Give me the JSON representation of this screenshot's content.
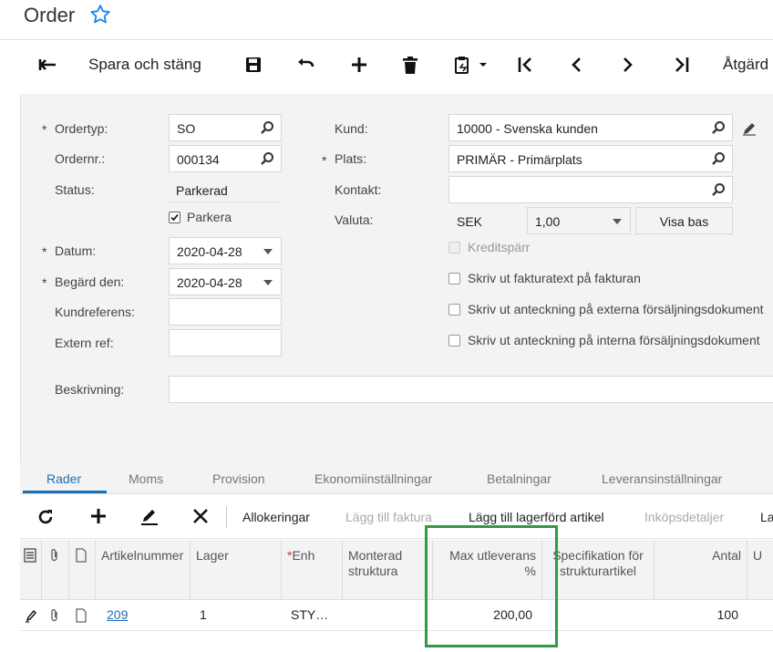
{
  "header": {
    "title": "Order"
  },
  "toolbar": {
    "save_close": "Spara och stäng",
    "actions": "Åtgärd"
  },
  "form": {
    "ordertyp_label": "Ordertyp:",
    "ordertyp_value": "SO",
    "ordernr_label": "Ordernr.:",
    "ordernr_value": "000134",
    "status_label": "Status:",
    "status_value": "Parkerad",
    "parkera_label": "Parkera",
    "datum_label": "Datum:",
    "datum_value": "2020-04-28",
    "begard_label": "Begärd den:",
    "begard_value": "2020-04-28",
    "kundref_label": "Kundreferens:",
    "kundref_value": "",
    "externref_label": "Extern ref:",
    "externref_value": "",
    "beskrivning_label": "Beskrivning:",
    "beskrivning_value": "",
    "kund_label": "Kund:",
    "kund_value": "10000 - Svenska kunden",
    "plats_label": "Plats:",
    "plats_value": "PRIMÄR - Primärplats",
    "kontakt_label": "Kontakt:",
    "kontakt_value": "",
    "valuta_label": "Valuta:",
    "valuta_code": "SEK",
    "valuta_rate": "1,00",
    "visa_bas": "Visa bas",
    "kreditsparr": "Kreditspärr",
    "skriv_fakturatext": "Skriv ut fakturatext på fakturan",
    "skriv_externa": "Skriv ut anteckning på externa försäljningsdokument",
    "skriv_interna": "Skriv ut anteckning på interna försäljningsdokument"
  },
  "tabs": [
    "Rader",
    "Moms",
    "Provision",
    "Ekonomiinställningar",
    "Betalningar",
    "Leveransinställningar"
  ],
  "grid_toolbar": {
    "allokeringar": "Allokeringar",
    "lagg_faktura": "Lägg till faktura",
    "lagg_lagerford": "Lägg till lagerförd artikel",
    "inkopsdetaljer": "Inköpsdetaljer",
    "more": "La"
  },
  "grid": {
    "headers": {
      "artikelnummer": "Artikelnummer",
      "lager": "Lager",
      "enh": "Enh",
      "monterad": "Monterad struktura",
      "max_utleverans": "Max utleverans %",
      "specifikation": "Specifikation för strukturartikel",
      "antal": "Antal",
      "u": "U"
    },
    "rows": [
      {
        "artikel": "209",
        "lager": "1",
        "enh": "STY…",
        "max_utleverans": "200,00",
        "antal": "100"
      }
    ]
  }
}
